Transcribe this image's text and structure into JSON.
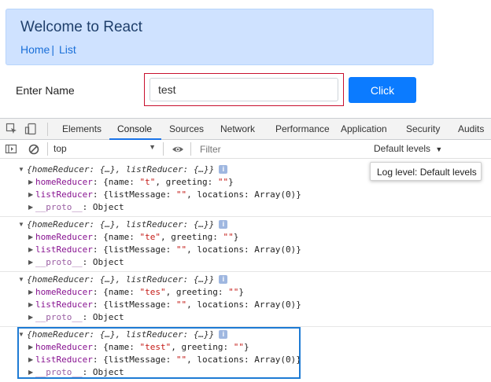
{
  "app": {
    "title": "Welcome to React",
    "nav": [
      {
        "label": "Home"
      },
      {
        "label": "List"
      }
    ],
    "nav_separator": "|",
    "form": {
      "label": "Enter Name",
      "input_value": "test",
      "button_label": "Click"
    }
  },
  "devtools": {
    "tabs": [
      {
        "label": "Elements"
      },
      {
        "label": "Console"
      },
      {
        "label": "Sources"
      },
      {
        "label": "Network"
      },
      {
        "label": "Performance"
      },
      {
        "label": "Application"
      },
      {
        "label": "Security"
      },
      {
        "label": "Audits"
      }
    ],
    "active_tab": "Console",
    "toolbar": {
      "context": "top",
      "filter_placeholder": "Filter",
      "levels_label": "Default levels",
      "levels_tooltip": "Log level: Default levels"
    },
    "entries": [
      {
        "summary": "{homeReducer: {…}, listReducer: {…}}",
        "home_name": "\"t\"",
        "home_greeting": "\"\"",
        "list_message": "\"\"",
        "locations": "Array(0)"
      },
      {
        "summary": "{homeReducer: {…}, listReducer: {…}}",
        "home_name": "\"te\"",
        "home_greeting": "\"\"",
        "list_message": "\"\"",
        "locations": "Array(0)"
      },
      {
        "summary": "{homeReducer: {…}, listReducer: {…}}",
        "home_name": "\"tes\"",
        "home_greeting": "\"\"",
        "list_message": "\"\"",
        "locations": "Array(0)"
      },
      {
        "summary": "{homeReducer: {…}, listReducer: {…}}",
        "home_name": "\"test\"",
        "home_greeting": "\"\"",
        "list_message": "\"\"",
        "locations": "Array(0)"
      }
    ],
    "labels": {
      "homeReducer": "homeReducer",
      "listReducer": "listReducer",
      "proto": "__proto__",
      "proto_value": "Object",
      "name_key": "name",
      "greeting_key": "greeting",
      "listMessage_key": "listMessage",
      "locations_key": "locations",
      "info": "i"
    },
    "highlight_color": "#1e7bd4",
    "accent_color": "#1a73e8"
  }
}
